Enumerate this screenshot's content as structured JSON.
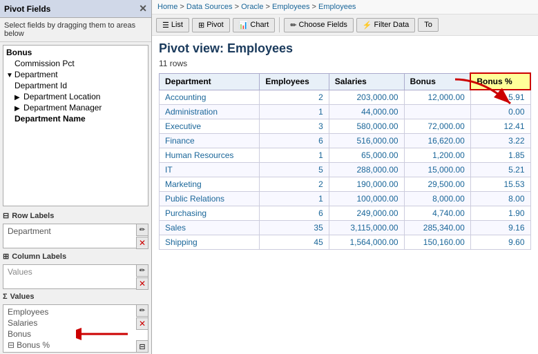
{
  "leftPanel": {
    "title": "Pivot Fields",
    "description": "Select fields by dragging them to areas below",
    "fields": [
      {
        "label": "Bonus",
        "bold": true,
        "indent": 0
      },
      {
        "label": "Commission Pct",
        "bold": false,
        "indent": 0
      },
      {
        "label": "Department",
        "bold": false,
        "indent": 0,
        "arrow": "▼"
      },
      {
        "label": "Department Id",
        "bold": false,
        "indent": 1
      },
      {
        "label": "Department Location",
        "bold": false,
        "indent": 1,
        "arrow": "▶"
      },
      {
        "label": "Department Manager",
        "bold": false,
        "indent": 1,
        "arrow": "▶"
      },
      {
        "label": "Department Name",
        "bold": true,
        "indent": 1
      }
    ],
    "rowLabels": {
      "sectionTitle": "Row Labels",
      "items": [
        "Department"
      ]
    },
    "columnLabels": {
      "sectionTitle": "Column Labels",
      "items": [
        "Values"
      ]
    },
    "values": {
      "sectionTitle": "Values",
      "items": [
        "Employees",
        "Salaries",
        "Bonus",
        "Bonus %"
      ]
    }
  },
  "breadcrumb": {
    "items": [
      "Home",
      "Data Sources",
      "Oracle",
      "Employees",
      "Employees"
    ]
  },
  "toolbar": {
    "buttons": [
      {
        "label": "List",
        "icon": "☰",
        "active": false
      },
      {
        "label": "Pivot",
        "icon": "⊞",
        "active": false
      },
      {
        "label": "Chart",
        "icon": "📊",
        "active": false
      },
      {
        "label": "Choose Fields",
        "icon": "✏",
        "active": false
      },
      {
        "label": "Filter Data",
        "icon": "⚡",
        "active": false
      },
      {
        "label": "To",
        "icon": "",
        "active": false
      }
    ]
  },
  "main": {
    "title": "Pivot view: Employees",
    "rowCount": "11 rows",
    "columns": [
      "Department",
      "Employees",
      "Salaries",
      "Bonus",
      "Bonus %"
    ],
    "rows": [
      {
        "dept": "Accounting",
        "employees": "2",
        "salaries": "203,000.00",
        "bonus": "12,000.00",
        "bonusPct": "5.91"
      },
      {
        "dept": "Administration",
        "employees": "1",
        "salaries": "44,000.00",
        "bonus": "",
        "bonusPct": "0.00"
      },
      {
        "dept": "Executive",
        "employees": "3",
        "salaries": "580,000.00",
        "bonus": "72,000.00",
        "bonusPct": "12.41"
      },
      {
        "dept": "Finance",
        "employees": "6",
        "salaries": "516,000.00",
        "bonus": "16,620.00",
        "bonusPct": "3.22"
      },
      {
        "dept": "Human Resources",
        "employees": "1",
        "salaries": "65,000.00",
        "bonus": "1,200.00",
        "bonusPct": "1.85"
      },
      {
        "dept": "IT",
        "employees": "5",
        "salaries": "288,000.00",
        "bonus": "15,000.00",
        "bonusPct": "5.21"
      },
      {
        "dept": "Marketing",
        "employees": "2",
        "salaries": "190,000.00",
        "bonus": "29,500.00",
        "bonusPct": "15.53"
      },
      {
        "dept": "Public Relations",
        "employees": "1",
        "salaries": "100,000.00",
        "bonus": "8,000.00",
        "bonusPct": "8.00"
      },
      {
        "dept": "Purchasing",
        "employees": "6",
        "salaries": "249,000.00",
        "bonus": "4,740.00",
        "bonusPct": "1.90"
      },
      {
        "dept": "Sales",
        "employees": "35",
        "salaries": "3,115,000.00",
        "bonus": "285,340.00",
        "bonusPct": "9.16"
      },
      {
        "dept": "Shipping",
        "employees": "45",
        "salaries": "1,564,000.00",
        "bonus": "150,160.00",
        "bonusPct": "9.60"
      }
    ]
  }
}
